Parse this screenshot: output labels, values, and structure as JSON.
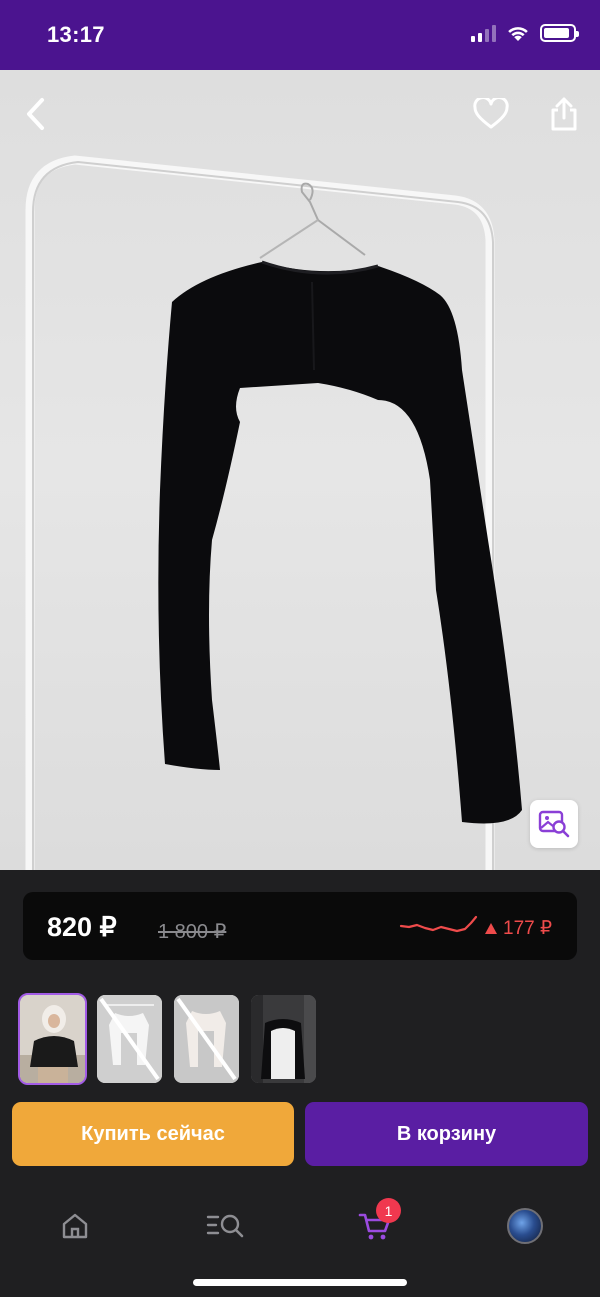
{
  "status_bar": {
    "time": "13:17",
    "background": "#4b148f",
    "signal_icon": "cellular-signal-icon",
    "wifi_icon": "wifi-icon",
    "battery_icon": "battery-icon",
    "battery_level": 0.9
  },
  "photo": {
    "back_icon": "chevron-left-icon",
    "favorite_icon": "heart-outline-icon",
    "share_icon": "share-icon",
    "visual_search_icon": "image-search-icon"
  },
  "price": {
    "current": "820 ₽",
    "old": "1 800 ₽",
    "change": "177 ₽",
    "change_icon": "triangle-up-icon",
    "trend_color": "#ef4b4b"
  },
  "thumbnails": [
    {
      "name": "thumb-model-front",
      "active": true
    },
    {
      "name": "thumb-white-crossed",
      "active": false
    },
    {
      "name": "thumb-white-crossed-2",
      "active": false
    },
    {
      "name": "thumb-black-white-hanger",
      "active": false
    }
  ],
  "actions": {
    "buy_now": "Купить сейчас",
    "add_to_cart": "В корзину",
    "buy_color": "#f0a83a",
    "cart_color": "#5a1ea3"
  },
  "tabbar": {
    "home_icon": "home-icon",
    "catalog_icon": "catalog-search-icon",
    "cart_icon": "cart-icon",
    "cart_count": "1",
    "profile_icon": "avatar"
  }
}
